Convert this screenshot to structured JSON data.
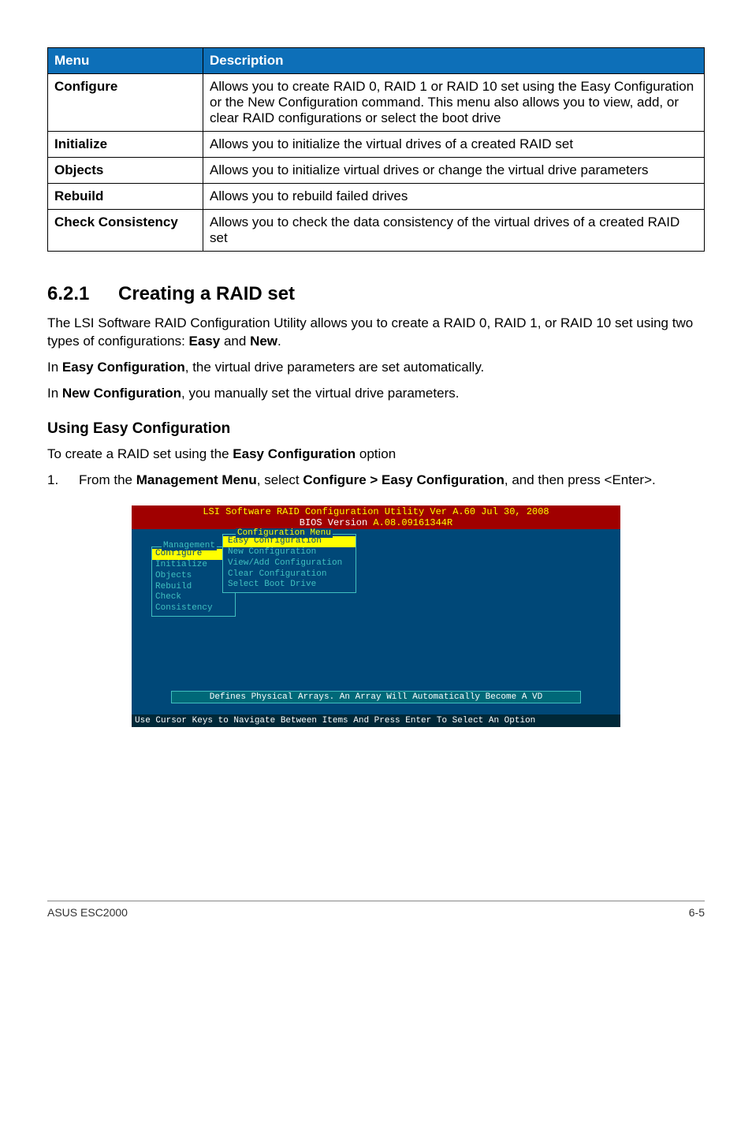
{
  "table": {
    "headers": [
      "Menu",
      "Description"
    ],
    "rows": [
      {
        "menu": "Configure",
        "desc": "Allows you to create RAID 0, RAID 1 or RAID 10 set using the Easy Configuration or the New Configuration command. This menu also allows you to view, add, or clear RAID configurations or select the boot drive"
      },
      {
        "menu": "Initialize",
        "desc": "Allows you to initialize the virtual drives of a created RAID set"
      },
      {
        "menu": "Objects",
        "desc": "Allows you to initialize virtual drives or change the virtual drive parameters"
      },
      {
        "menu": "Rebuild",
        "desc": "Allows you to rebuild failed drives"
      },
      {
        "menu": "Check Consistency",
        "desc": "Allows you to check the data consistency of the virtual drives of a created RAID set"
      }
    ]
  },
  "section": {
    "number": "6.2.1",
    "title": "Creating a RAID set",
    "p1_a": "The LSI Software RAID Configuration Utility allows you to create a RAID 0, RAID 1, or RAID 10 set using two types of configurations: ",
    "p1_b": "Easy",
    "p1_c": " and ",
    "p1_d": "New",
    "p1_e": ".",
    "p2_a": "In ",
    "p2_b": "Easy Configuration",
    "p2_c": ", the virtual drive parameters are set automatically.",
    "p3_a": "In ",
    "p3_b": "New Configuration",
    "p3_c": ", you manually set the virtual drive parameters."
  },
  "sub": {
    "heading": "Using Easy Configuration",
    "intro_a": "To create a RAID set using the ",
    "intro_b": "Easy Configuration",
    "intro_c": " option",
    "step1_num": "1.",
    "step1_a": "From the ",
    "step1_b": "Management Menu",
    "step1_c": ", select ",
    "step1_d": "Configure > Easy Configuration",
    "step1_e": ", and then press <Enter>."
  },
  "bios": {
    "header_line1": "LSI Software RAID Configuration Utility Ver A.60 Jul 30, 2008",
    "header_line2_a": "BIOS Version ",
    "header_line2_b": "A.08.09161344R",
    "mgmt_title": "Management",
    "mgmt_items": [
      "Configure",
      "Initialize",
      "Objects",
      "Rebuild",
      "Check Consistency"
    ],
    "cfg_title": "Configuration Menu",
    "cfg_items": [
      "Easy Configuration",
      "New Configuration",
      "View/Add Configuration",
      "Clear Configuration",
      "Select Boot Drive"
    ],
    "status": "Defines Physical Arrays. An Array Will Automatically Become A VD",
    "footer": "Use Cursor Keys to Navigate Between Items And Press Enter To Select An Option"
  },
  "footer": {
    "left": "ASUS ESC2000",
    "right": "6-5"
  }
}
